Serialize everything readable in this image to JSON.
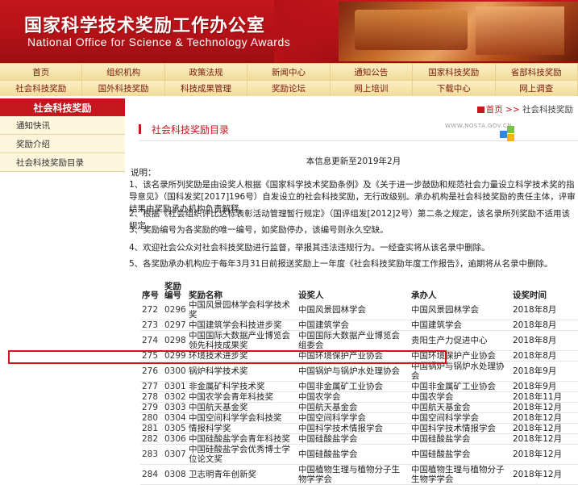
{
  "header": {
    "title_cn": "国家科学技术奖励工作办公室",
    "title_en": "National Office for Science & Technology Awards"
  },
  "nav": {
    "row1": [
      "首页",
      "组织机构",
      "政策法规",
      "新闻中心",
      "通知公告",
      "国家科技奖励",
      "省部科技奖励"
    ],
    "row2": [
      "社会科技奖励",
      "国外科技奖励",
      "科技成果管理",
      "奖励论坛",
      "网上培训",
      "下载中心",
      "网上调查"
    ]
  },
  "sidebar": {
    "title": "社会科技奖励",
    "items": [
      "通知快讯",
      "奖励介绍",
      "社会科技奖励目录"
    ]
  },
  "breadcrumb": {
    "home": "首页",
    "sep": ">>",
    "current": "社会科技奖励"
  },
  "section": {
    "title": "社会科技奖励目录",
    "site_url": "WWW.NOSTA.GOV.CN"
  },
  "content": {
    "update": "本信息更新至2019年2月",
    "shuoming": "说明：",
    "paras": [
      "1、该名录所列奖励是由设奖人根据《国家科学技术奖励条例》及《关于进一步鼓励和规范社会力量设立科学技术奖的指导意见》（国科发奖[2017]196号）自发设立的社会科技奖励，无行政级别。承办机构是社会科技奖励的责任主体，评审结果由奖励承办机构负责解释。",
      "2、根据《社会组织评比达标表彰活动管理暂行规定》（国评组发[2012]2号）第二条之规定，该名录所列奖励不适用该规定。",
      "3、奖励编号为各奖励的唯一编号，如奖励停办，该编号则永久空缺。",
      "4、欢迎社会公众对社会科技奖励进行监督，举报其违法违规行为。一经查实将从该名录中删除。",
      "5、各奖励承办机构应于每年3月31日前报送奖励上一年度《社会科技奖励年度工作报告》，逾期将从名录中删除。"
    ]
  },
  "table": {
    "headers": [
      "序号",
      "奖励编号",
      "奖励名称",
      "设奖人",
      "承办人",
      "设奖时间"
    ],
    "rows": [
      [
        "272",
        "0296",
        "中国风景园林学会科学技术奖",
        "中国风景园林学会",
        "中国风景园林学会",
        "2018年8月"
      ],
      [
        "273",
        "0297",
        "中国建筑学会科技进步奖",
        "中国建筑学会",
        "中国建筑学会",
        "2018年8月"
      ],
      [
        "274",
        "0298",
        "中国国际大数据产业博览会领先科技成果奖",
        "中国国际大数据产业博览会组委会",
        "贵阳生产力促进中心",
        "2018年8月"
      ],
      [
        "275",
        "0299",
        "环境技术进步奖",
        "中国环境保护产业协会",
        "中国环境保护产业协会",
        "2018年8月"
      ],
      [
        "276",
        "0300",
        "锅炉科学技术奖",
        "中国锅炉与锅炉水处理协会",
        "中国锅炉与锅炉水处理协会",
        "2018年9月"
      ],
      [
        "277",
        "0301",
        "非金属矿科学技术奖",
        "中国非金属矿工业协会",
        "中国非金属矿工业协会",
        "2018年9月"
      ],
      [
        "278",
        "0302",
        "中国农学会青年科技奖",
        "中国农学会",
        "中国农学会",
        "2018年11月"
      ],
      [
        "279",
        "0303",
        "中国航天基金奖",
        "中国航天基金会",
        "中国航天基金会",
        "2018年12月"
      ],
      [
        "280",
        "0304",
        "中国空间科学学会科技奖",
        "中国空间科学学会",
        "中国空间科学学会",
        "2018年12月"
      ],
      [
        "281",
        "0305",
        "情报科学奖",
        "中国科学技术情报学会",
        "中国科学技术情报学会",
        "2018年12月"
      ],
      [
        "282",
        "0306",
        "中国硅酸盐学会青年科技奖",
        "中国硅酸盐学会",
        "中国硅酸盐学会",
        "2018年12月"
      ],
      [
        "283",
        "0307",
        "中国硅酸盐学会优秀博士学位论文奖",
        "中国硅酸盐学会",
        "中国硅酸盐学会",
        "2018年12月"
      ],
      [
        "284",
        "0308",
        "卫志明青年创新奖",
        "中国植物生理与植物分子生物学学会",
        "中国植物生理与植物分子生物学学会",
        "2018年12月"
      ]
    ]
  },
  "colors": {
    "brand_red": "#c4161c",
    "nav_bg": "#f3e2a6",
    "highlight_border": "#d4141c"
  }
}
